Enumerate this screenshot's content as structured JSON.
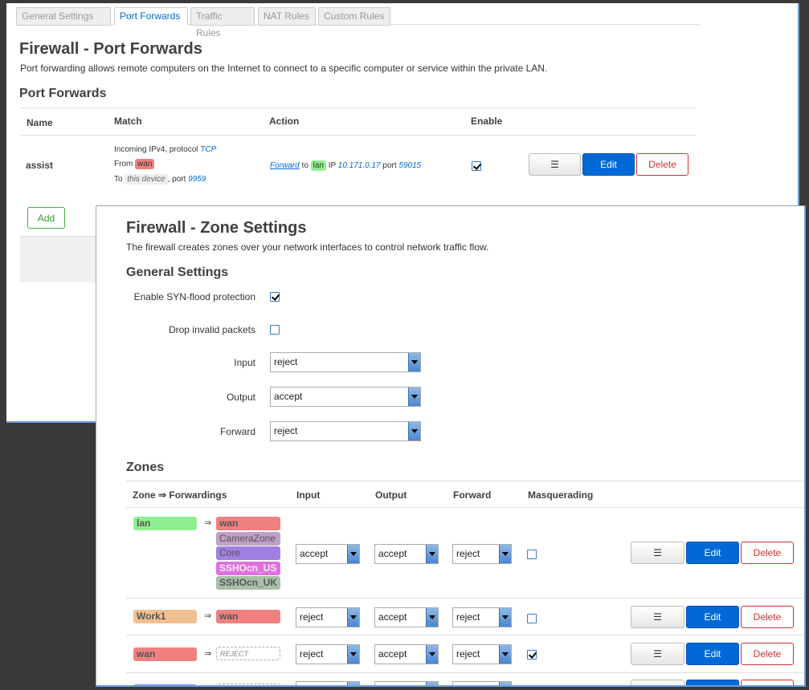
{
  "top_window": {
    "tabs": [
      "General Settings",
      "Port Forwards",
      "Traffic Rules",
      "NAT Rules",
      "Custom Rules"
    ],
    "title": "Firewall - Port Forwards",
    "description": "Port forwarding allows remote computers on the Internet to connect to a specific computer or service within the private LAN.",
    "section_title": "Port Forwards",
    "columns": {
      "name": "Name",
      "match": "Match",
      "action": "Action",
      "enable": "Enable"
    },
    "rule": {
      "name": "assist",
      "match_line1_prefix": "Incoming IPv4, protocol ",
      "protocol": "TCP",
      "from_prefix": "From ",
      "from_zone": "wan",
      "to_prefix": "To ",
      "to_device": "this device",
      "port_prefix": ", port ",
      "port": "9959",
      "action_verb": "Forward",
      "action_to": " to ",
      "action_zone": "lan",
      "action_ip_label": " IP ",
      "action_ip": "10.171.0.17",
      "action_port_label": " port ",
      "action_port": "59015",
      "enabled": true
    },
    "buttons": {
      "menu": "☰",
      "edit": "Edit",
      "delete": "Delete",
      "add": "Add"
    }
  },
  "zone_window": {
    "title": "Firewall - Zone Settings",
    "description": "The firewall creates zones over your network interfaces to control network traffic flow.",
    "general_title": "General Settings",
    "syn_label": "Enable SYN-flood protection",
    "syn_checked": true,
    "drop_label": "Drop invalid packets",
    "drop_checked": false,
    "input_label": "Input",
    "input_value": "reject",
    "output_label": "Output",
    "output_value": "accept",
    "forward_label": "Forward",
    "forward_value": "reject",
    "zones_title": "Zones",
    "columns": {
      "zone": "Zone ⇒ Forwardings",
      "input": "Input",
      "output": "Output",
      "forward": "Forward",
      "masq": "Masquerading"
    },
    "arrow": "⇒",
    "rows": [
      {
        "zone": "lan",
        "zone_color": "#90ee90",
        "forwards": [
          {
            "name": "wan",
            "color": "#f08080"
          },
          {
            "name": "CameraZone",
            "color": "#c0a0c8"
          },
          {
            "name": "Core",
            "color": "#a080e0"
          },
          {
            "name": "SSHOcn_US",
            "color": "#e070e0"
          },
          {
            "name": "SSHOcn_UK",
            "color": "#a8c0a8"
          }
        ],
        "input": "accept",
        "output": "accept",
        "forward": "reject",
        "masq": false
      },
      {
        "zone": "Work1",
        "zone_color": "#f0c090",
        "forwards": [
          {
            "name": "wan",
            "color": "#f08080"
          }
        ],
        "input": "reject",
        "output": "accept",
        "forward": "reject",
        "masq": false
      },
      {
        "zone": "wan",
        "zone_color": "#f08080",
        "forwards": [
          {
            "name": "REJECT",
            "color": "#ffffff"
          }
        ],
        "input": "reject",
        "output": "accept",
        "forward": "reject",
        "masq": true
      }
    ],
    "buttons": {
      "menu": "☰",
      "edit": "Edit",
      "delete": "Delete"
    }
  }
}
